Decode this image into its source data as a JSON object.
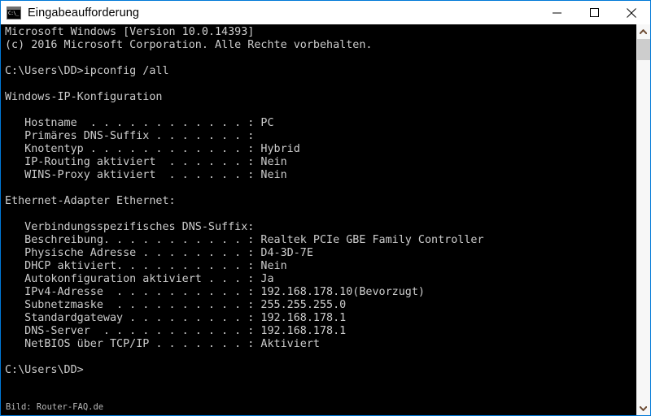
{
  "window": {
    "title": "Eingabeaufforderung",
    "icon_name": "cmd-console-icon",
    "icon_glyph": "C:\\_",
    "border_color": "#0078d7",
    "titlebar_bg": "#ffffff",
    "console_bg": "#000000",
    "console_fg": "#cccccc"
  },
  "titlebar_buttons": {
    "minimize_label": "—",
    "maximize_label": "□",
    "close_label": "✕"
  },
  "scrollbar": {
    "up_arrow_label": "∧",
    "down_arrow_label": "∨",
    "thumb_color": "#cdcdcd",
    "track_color": "#f7f7f7",
    "arrow_color": "#6d4c34"
  },
  "console": {
    "lines": [
      "Microsoft Windows [Version 10.0.14393]",
      "(c) 2016 Microsoft Corporation. Alle Rechte vorbehalten.",
      "",
      "C:\\Users\\DD>ipconfig /all",
      "",
      "Windows-IP-Konfiguration",
      "",
      "   Hostname  . . . . . . . . . . . . : PC",
      "   Primäres DNS-Suffix . . . . . . . :",
      "   Knotentyp . . . . . . . . . . . . : Hybrid",
      "   IP-Routing aktiviert  . . . . . . : Nein",
      "   WINS-Proxy aktiviert  . . . . . . : Nein",
      "",
      "Ethernet-Adapter Ethernet:",
      "",
      "   Verbindungsspezifisches DNS-Suffix:",
      "   Beschreibung. . . . . . . . . . . : Realtek PCIe GBE Family Controller",
      "   Physische Adresse . . . . . . . . : D4-3D-7E",
      "   DHCP aktiviert. . . . . . . . . . : Nein",
      "   Autokonfiguration aktiviert . . . : Ja",
      "   IPv4-Adresse  . . . . . . . . . . : 192.168.178.10(Bevorzugt)",
      "   Subnetzmaske  . . . . . . . . . . : 255.255.255.0",
      "   Standardgateway . . . . . . . . . : 192.168.178.1",
      "   DNS-Server  . . . . . . . . . . . : 192.168.178.1",
      "   NetBIOS über TCP/IP . . . . . . . : Aktiviert",
      "",
      "C:\\Users\\DD>"
    ],
    "text": "Microsoft Windows [Version 10.0.14393]\n(c) 2016 Microsoft Corporation. Alle Rechte vorbehalten.\n\nC:\\Users\\DD>ipconfig /all\n\nWindows-IP-Konfiguration\n\n   Hostname  . . . . . . . . . . . . : PC\n   Primäres DNS-Suffix . . . . . . . :\n   Knotentyp . . . . . . . . . . . . : Hybrid\n   IP-Routing aktiviert  . . . . . . : Nein\n   WINS-Proxy aktiviert  . . . . . . : Nein\n\nEthernet-Adapter Ethernet:\n\n   Verbindungsspezifisches DNS-Suffix:\n   Beschreibung. . . . . . . . . . . : Realtek PCIe GBE Family Controller\n   Physische Adresse . . . . . . . . : D4-3D-7E\n   DHCP aktiviert. . . . . . . . . . : Nein\n   Autokonfiguration aktiviert . . . : Ja\n   IPv4-Adresse  . . . . . . . . . . : 192.168.178.10(Bevorzugt)\n   Subnetzmaske  . . . . . . . . . . : 255.255.255.0\n   Standardgateway . . . . . . . . . : 192.168.178.1\n   DNS-Server  . . . . . . . . . . . : 192.168.178.1\n   NetBIOS über TCP/IP . . . . . . . : Aktiviert\n\nC:\\Users\\DD>",
    "command": "ipconfig /all",
    "prompt": "C:\\Users\\DD>",
    "values": {
      "hostname": "PC",
      "primaeres_dns_suffix": "",
      "knotentyp": "Hybrid",
      "ip_routing_aktiviert": "Nein",
      "wins_proxy_aktiviert": "Nein",
      "adapter": "Ethernet-Adapter Ethernet:",
      "verbindungsspezifisches_dns_suffix": "",
      "beschreibung": "Realtek PCIe GBE Family Controller",
      "physische_adresse": "D4-3D-7E",
      "dhcp_aktiviert": "Nein",
      "autokonfiguration_aktiviert": "Ja",
      "ipv4_adresse": "192.168.178.10(Bevorzugt)",
      "subnetzmaske": "255.255.255.0",
      "standardgateway": "192.168.178.1",
      "dns_server": "192.168.178.1",
      "netbios_ueber_tcpip": "Aktiviert"
    }
  },
  "watermark": {
    "text": "Bild: Router-FAQ.de"
  }
}
